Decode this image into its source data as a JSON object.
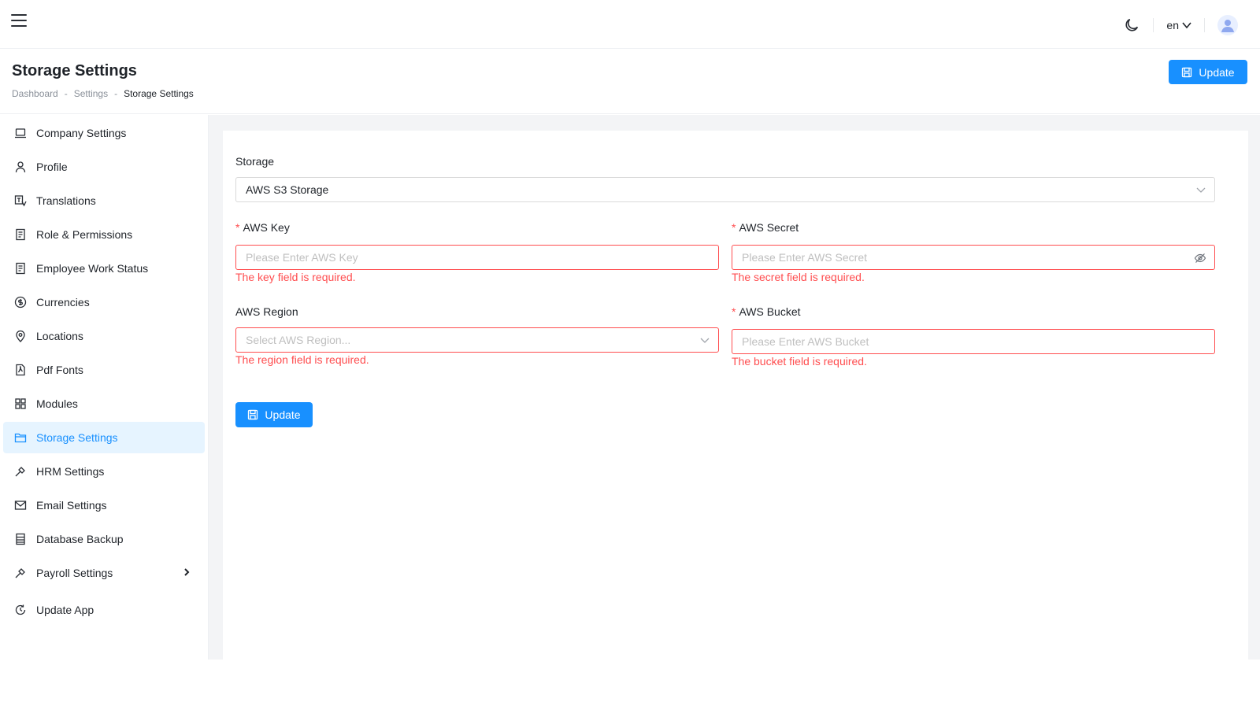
{
  "topbar": {
    "lang": "en"
  },
  "header": {
    "title": "Storage Settings",
    "breadcrumb": [
      "Dashboard",
      "-",
      "Settings",
      "-",
      "Storage Settings"
    ],
    "update_label": "Update"
  },
  "sidebar": {
    "items": [
      {
        "label": "Company Settings",
        "icon": "laptop-icon"
      },
      {
        "label": "Profile",
        "icon": "user-icon"
      },
      {
        "label": "Translations",
        "icon": "translate-icon"
      },
      {
        "label": "Role & Permissions",
        "icon": "document-icon"
      },
      {
        "label": "Employee Work Status",
        "icon": "document-icon"
      },
      {
        "label": "Currencies",
        "icon": "dollar-icon"
      },
      {
        "label": "Locations",
        "icon": "location-icon"
      },
      {
        "label": "Pdf Fonts",
        "icon": "pdf-icon"
      },
      {
        "label": "Modules",
        "icon": "modules-icon"
      },
      {
        "label": "Storage Settings",
        "icon": "folder-icon",
        "active": true
      },
      {
        "label": "HRM Settings",
        "icon": "tool-icon"
      },
      {
        "label": "Email Settings",
        "icon": "mail-icon"
      },
      {
        "label": "Database Backup",
        "icon": "database-icon"
      },
      {
        "label": "Payroll Settings",
        "icon": "tool-icon"
      },
      {
        "label": "Update App",
        "icon": "history-icon"
      }
    ]
  },
  "form": {
    "storage_label": "Storage",
    "storage_value": "AWS S3 Storage",
    "key_label": "AWS Key",
    "key_placeholder": "Please Enter AWS Key",
    "key_error": "The key field is required.",
    "secret_label": "AWS Secret",
    "secret_placeholder": "Please Enter AWS Secret",
    "secret_error": "The secret field is required.",
    "region_label": "AWS Region",
    "region_placeholder": "Select AWS Region...",
    "region_error": "The region field is required.",
    "bucket_label": "AWS Bucket",
    "bucket_placeholder": "Please Enter AWS Bucket",
    "bucket_error": "The bucket field is required.",
    "update_label": "Update",
    "required_mark": "*"
  },
  "colors": {
    "primary": "#1890ff",
    "error": "#ff4d4f",
    "active_bg": "#e6f4ff"
  }
}
